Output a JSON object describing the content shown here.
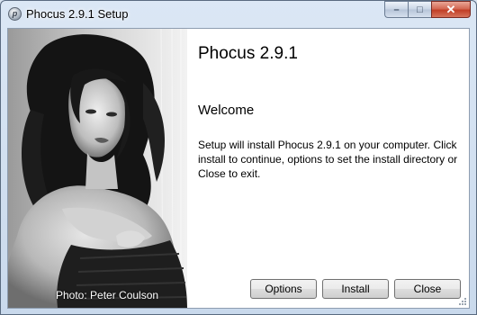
{
  "window": {
    "title": "Phocus 2.9.1 Setup",
    "icon": "app-icon",
    "caption": {
      "minimize": "–",
      "maximize": "□",
      "close": "✕"
    }
  },
  "main": {
    "product_title": "Phocus 2.9.1",
    "welcome_heading": "Welcome",
    "message": "Setup will install Phocus 2.9.1 on your computer. Click install to continue, options to set the install directory or Close to exit.",
    "photo_credit": "Photo: Peter Coulson"
  },
  "buttons": {
    "options": "Options",
    "install": "Install",
    "close": "Close"
  }
}
